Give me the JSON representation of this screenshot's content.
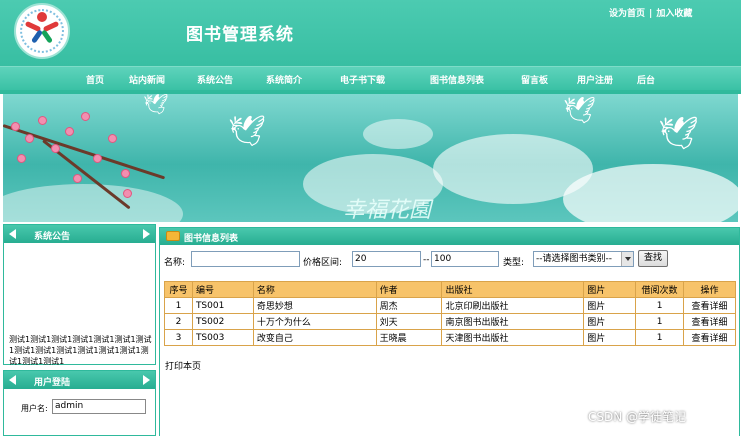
{
  "header": {
    "title": "图书管理系统",
    "top_links": {
      "set_home": "设为首页",
      "separator": "|",
      "favorite": "加入收藏"
    }
  },
  "nav": {
    "items": [
      {
        "label": "首页"
      },
      {
        "label": "站内新闻"
      },
      {
        "label": "系统公告"
      },
      {
        "label": "系统简介"
      },
      {
        "label": "电子书下载"
      },
      {
        "label": "图书信息列表"
      },
      {
        "label": "留言板"
      },
      {
        "label": "用户注册"
      },
      {
        "label": "后台"
      }
    ]
  },
  "banner": {
    "text": "幸福花園"
  },
  "sidebar": {
    "notice": {
      "title": "系统公告",
      "content": "测试1测试1测试1测试1测试1测试1测试1测试1测试1测试1测试1测试1测试1测试1测试1测试1"
    },
    "login": {
      "title": "用户登陆",
      "username_label": "用户名:",
      "username_value": "admin"
    }
  },
  "main": {
    "title": "图书信息列表",
    "search": {
      "name_label": "名称:",
      "name_value": "",
      "price_label": "价格区间:",
      "price_min": "20",
      "price_sep": "--",
      "price_max": "100",
      "type_label": "类型:",
      "type_selected": "--请选择图书类别--",
      "button": "查找"
    },
    "table": {
      "headers": [
        "序号",
        "编号",
        "名称",
        "作者",
        "出版社",
        "图片",
        "借阅次数",
        "操作"
      ],
      "rows": [
        {
          "seq": "1",
          "code": "TS001",
          "name": "奇思妙想",
          "author": "周杰",
          "publisher": "北京印刷出版社",
          "image": "图片",
          "borrow": "1",
          "action": "查看详细"
        },
        {
          "seq": "2",
          "code": "TS002",
          "name": "十万个为什么",
          "author": "刘天",
          "publisher": "南京图书出版社",
          "image": "图片",
          "borrow": "1",
          "action": "查看详细"
        },
        {
          "seq": "3",
          "code": "TS003",
          "name": "改变自己",
          "author": "王晓晨",
          "publisher": "天津图书出版社",
          "image": "图片",
          "borrow": "1",
          "action": "查看详细"
        }
      ]
    },
    "print_label": "打印本页"
  },
  "watermark": "CSDN @学徒笔记",
  "colors": {
    "theme_green": "#2fb99c",
    "table_header": "#f7c36a"
  }
}
